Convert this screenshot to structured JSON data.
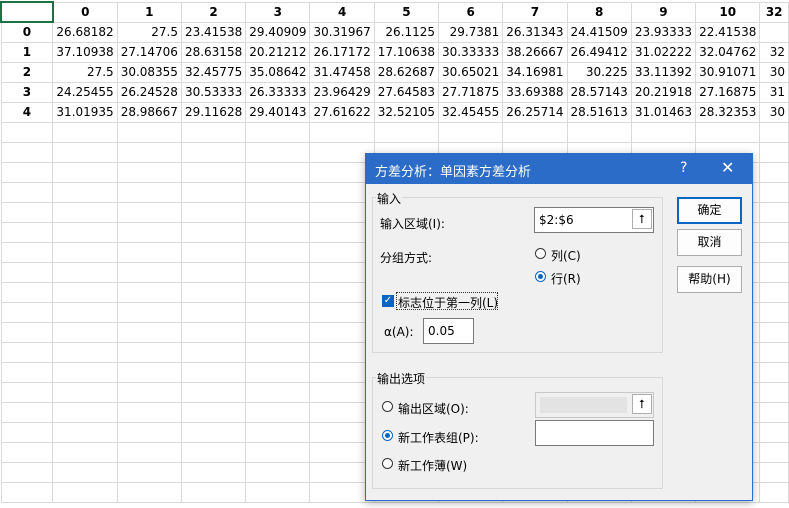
{
  "sheet": {
    "columns": [
      "0",
      "1",
      "2",
      "3",
      "4",
      "5",
      "6",
      "7",
      "8",
      "9",
      "10",
      "32"
    ],
    "rows": [
      {
        "label": "0",
        "cells": [
          "26.68182",
          "27.5",
          "23.41538",
          "29.40909",
          "30.31967",
          "26.1125",
          "29.7381",
          "26.31343",
          "24.41509",
          "23.93333",
          "22.41538",
          ""
        ]
      },
      {
        "label": "1",
        "cells": [
          "37.10938",
          "27.14706",
          "28.63158",
          "20.21212",
          "26.17172",
          "17.10638",
          "30.33333",
          "38.26667",
          "26.49412",
          "31.02222",
          "32.04762",
          "32"
        ]
      },
      {
        "label": "2",
        "cells": [
          "27.5",
          "30.08355",
          "32.45775",
          "35.08642",
          "31.47458",
          "28.62687",
          "30.65021",
          "34.16981",
          "30.225",
          "33.11392",
          "30.91071",
          "30"
        ]
      },
      {
        "label": "3",
        "cells": [
          "24.25455",
          "26.24528",
          "30.53333",
          "26.33333",
          "23.96429",
          "27.64583",
          "27.71875",
          "33.69388",
          "28.57143",
          "20.21918",
          "27.16875",
          "31"
        ]
      },
      {
        "label": "4",
        "cells": [
          "31.01935",
          "28.98667",
          "29.11628",
          "29.40143",
          "27.61622",
          "32.52105",
          "32.45455",
          "26.25714",
          "28.51613",
          "31.01463",
          "28.32353",
          "30"
        ]
      }
    ]
  },
  "dialog": {
    "title": "方差分析：单因素方差分析",
    "help_glyph": "?",
    "close_glyph": "✕",
    "input_group": "输入",
    "input_range_label": "输入区域(I):",
    "input_range_value": "$2:$6",
    "group_by_label": "分组方式:",
    "radio_column": "列(C)",
    "radio_row": "行(R)",
    "labels_first_col": "标志位于第一列(L)",
    "alpha_label": "α(A):",
    "alpha_value": "0.05",
    "output_group": "输出选项",
    "output_range": "输出区域(O):",
    "new_worksheet": "新工作表组(P):",
    "new_workbook": "新工作薄(W)",
    "ok_button": "确定",
    "cancel_button": "取消",
    "help_button": "帮助(H)",
    "ref_icon": "⭡"
  }
}
